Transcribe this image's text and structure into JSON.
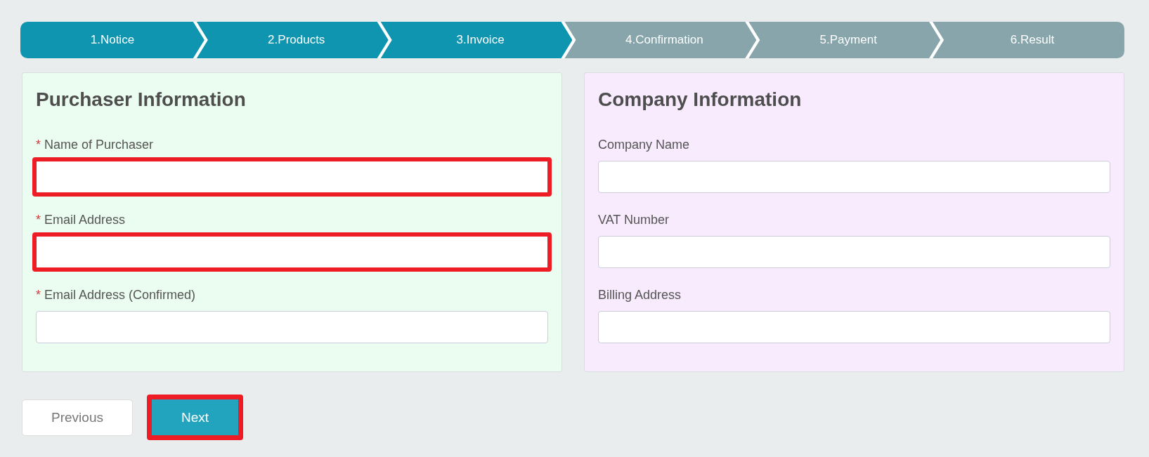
{
  "steps": [
    {
      "label": "1.Notice",
      "reached": true
    },
    {
      "label": "2.Products",
      "reached": true
    },
    {
      "label": "3.Invoice",
      "reached": true
    },
    {
      "label": "4.Confirmation",
      "reached": false
    },
    {
      "label": "5.Payment",
      "reached": false
    },
    {
      "label": "6.Result",
      "reached": false
    }
  ],
  "panels": [
    {
      "title": "Purchaser Information",
      "color": "#ebfdf1",
      "fields": [
        {
          "required_mark": "*",
          "label": "Name of Purchaser",
          "highlighted": true
        },
        {
          "required_mark": "*",
          "label": "Email Address",
          "highlighted": true
        },
        {
          "required_mark": "*",
          "label": "Email Address (Confirmed)",
          "highlighted": false
        }
      ]
    },
    {
      "title": "Company Information",
      "color": "#f7ebfd",
      "fields": [
        {
          "label": "Company Name",
          "highlighted": false
        },
        {
          "label": "VAT Number",
          "highlighted": false
        },
        {
          "label": "Billing Address",
          "highlighted": false
        }
      ]
    }
  ],
  "buttons": [
    {
      "label": "Previous",
      "kind": "secondary",
      "highlighted": false
    },
    {
      "label": "Next",
      "kind": "primary",
      "highlighted": true
    }
  ]
}
